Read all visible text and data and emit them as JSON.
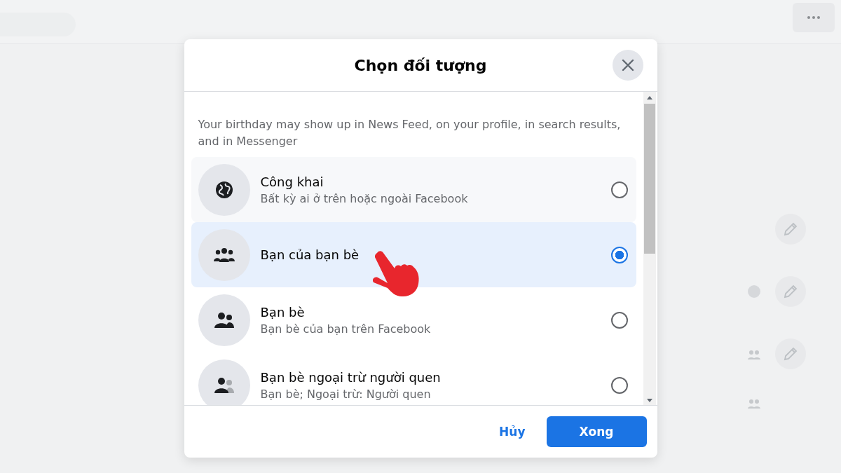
{
  "dialog": {
    "title": "Chọn đối tượng",
    "description": "Your birthday may show up in News Feed, on your profile, in search results, and in Messenger",
    "options": [
      {
        "title": "Công khai",
        "subtitle": "Bất kỳ ai ở trên hoặc ngoài Facebook",
        "selected": false
      },
      {
        "title": "Bạn của bạn bè",
        "selected": true
      },
      {
        "title": "Bạn bè",
        "subtitle": "Bạn bè của bạn trên Facebook",
        "selected": false
      },
      {
        "title": "Bạn bè ngoại trừ người quen",
        "subtitle": "Bạn bè; Ngoại trừ: Người quen",
        "selected": false
      }
    ],
    "cancel": "Hủy",
    "done": "Xong"
  }
}
